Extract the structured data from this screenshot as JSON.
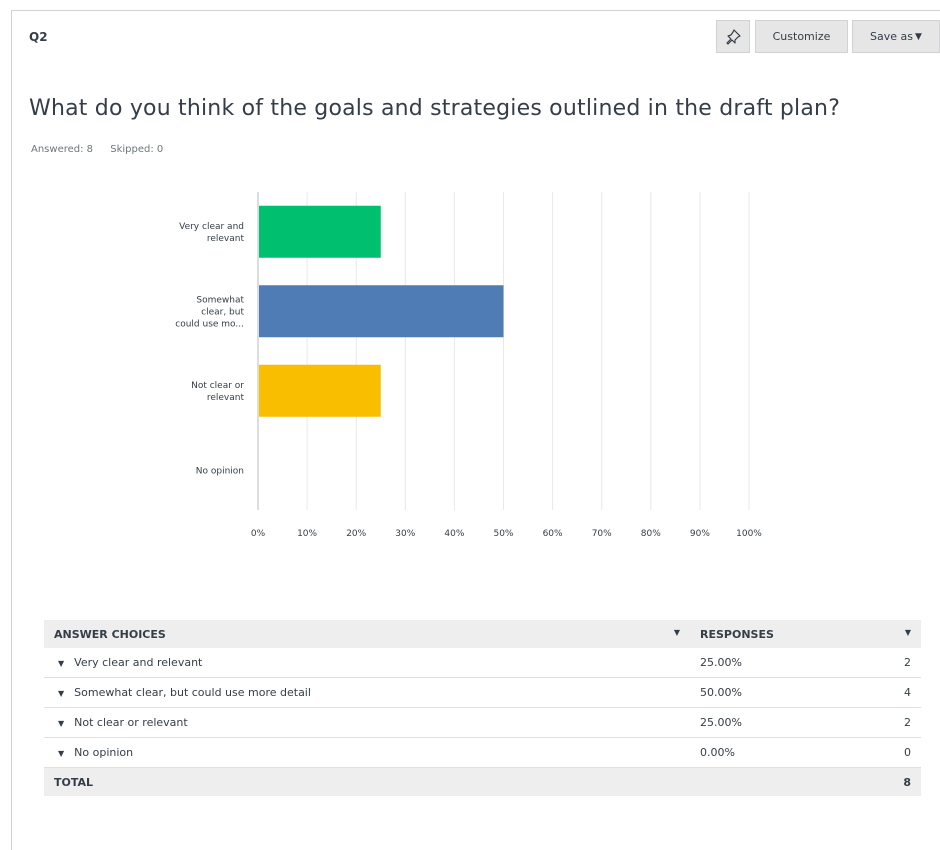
{
  "question": {
    "number": "Q2",
    "title": "What do you think of the goals and strategies outlined in the draft plan?",
    "answered": "Answered: 8",
    "skipped": "Skipped: 0"
  },
  "toolbar": {
    "pin_icon": "pin-icon",
    "customize_label": "Customize",
    "save_as_label": "Save as"
  },
  "chart_data": {
    "type": "bar",
    "orientation": "horizontal",
    "categories_display": [
      "Very clear and\nrelevant",
      "Somewhat\nclear, but\ncould use mo...",
      "Not clear or\nrelevant",
      "No opinion"
    ],
    "categories": [
      "Very clear and relevant",
      "Somewhat clear, but could use more detail",
      "Not clear or relevant",
      "No opinion"
    ],
    "values": [
      25,
      50,
      25,
      0
    ],
    "colors": [
      "#00bf6f",
      "#507cb6",
      "#f9be00",
      "#6bc8cd"
    ],
    "xlim": [
      0,
      100
    ],
    "xticks": [
      "0%",
      "10%",
      "20%",
      "30%",
      "40%",
      "50%",
      "60%",
      "70%",
      "80%",
      "90%",
      "100%"
    ],
    "grid": true
  },
  "table": {
    "headers": [
      "ANSWER CHOICES",
      "RESPONSES"
    ],
    "rows": [
      {
        "choice": "Very clear and relevant",
        "percent": "25.00%",
        "count": "2"
      },
      {
        "choice": "Somewhat clear, but could use more detail",
        "percent": "50.00%",
        "count": "4"
      },
      {
        "choice": "Not clear or relevant",
        "percent": "25.00%",
        "count": "2"
      },
      {
        "choice": "No opinion",
        "percent": "0.00%",
        "count": "0"
      }
    ],
    "total_label": "TOTAL",
    "total_count": "8"
  }
}
